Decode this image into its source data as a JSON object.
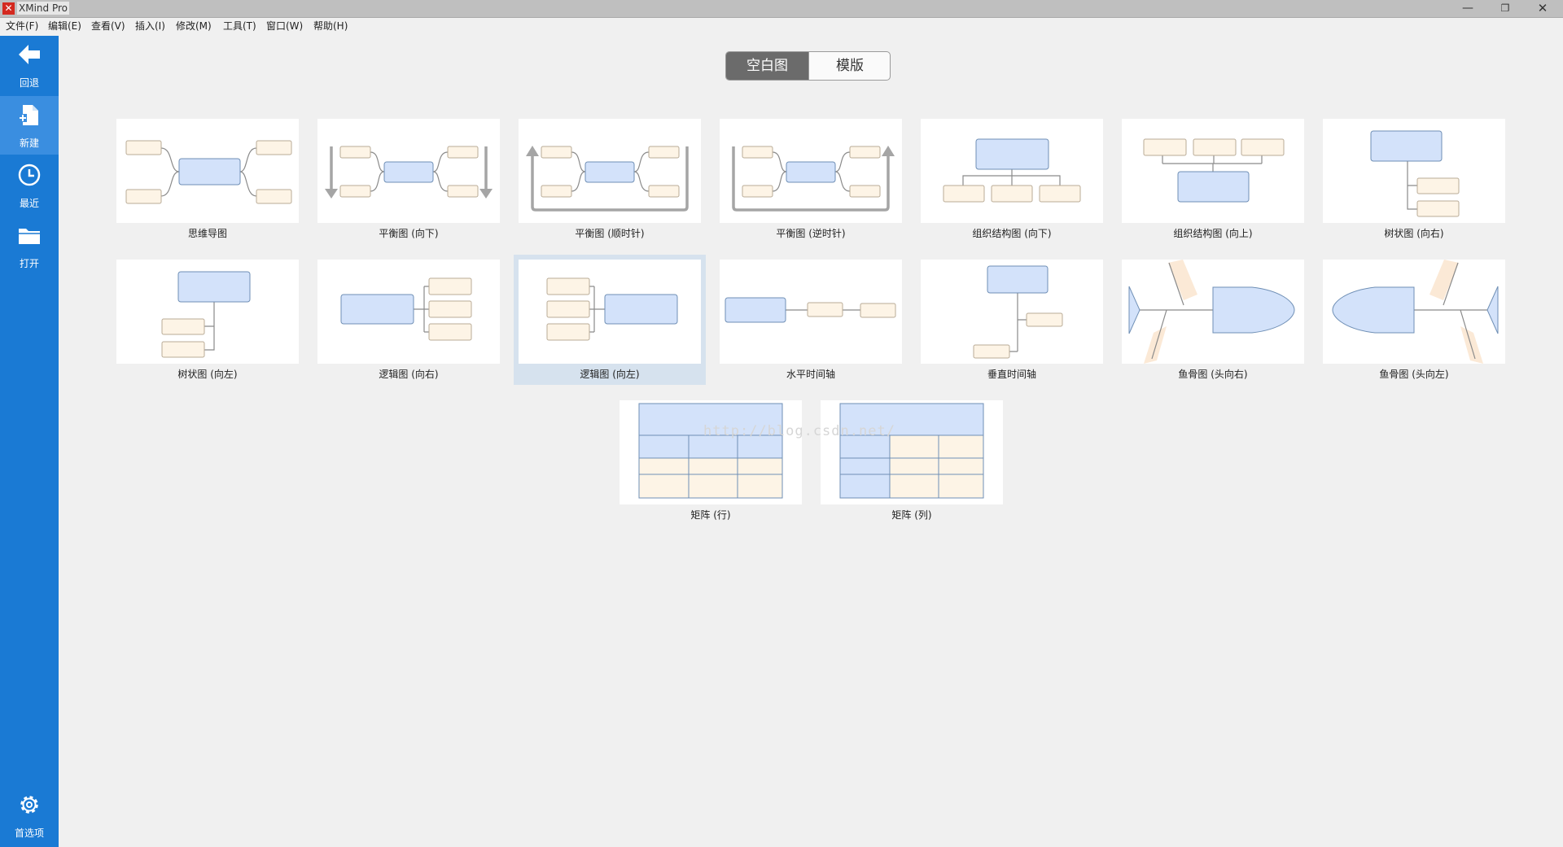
{
  "app": {
    "title": "XMind Pro",
    "icon": "xmind-logo-icon"
  },
  "window_controls": {
    "minimize": "—",
    "maximize": "❐",
    "close": "✕"
  },
  "menu": [
    "文件(F)",
    "编辑(E)",
    "查看(V)",
    "插入(I)",
    "修改(M)",
    "工具(T)",
    "窗口(W)",
    "帮助(H)"
  ],
  "sidebar": {
    "items": [
      {
        "label": "回退",
        "icon": "back-arrow-icon"
      },
      {
        "label": "新建",
        "icon": "new-document-icon",
        "active": true
      },
      {
        "label": "最近",
        "icon": "clock-icon"
      },
      {
        "label": "打开",
        "icon": "folder-icon"
      }
    ],
    "preferences": {
      "label": "首选项",
      "icon": "gear-icon"
    }
  },
  "tabs": {
    "blank": "空白图",
    "templates": "模版",
    "active": "空白图"
  },
  "templates": [
    {
      "label": "思维导图"
    },
    {
      "label": "平衡图 (向下)"
    },
    {
      "label": "平衡图 (顺时针)"
    },
    {
      "label": "平衡图 (逆时针)"
    },
    {
      "label": "组织结构图 (向下)"
    },
    {
      "label": "组织结构图 (向上)"
    },
    {
      "label": "树状图 (向右)"
    },
    {
      "label": "树状图 (向左)"
    },
    {
      "label": "逻辑图 (向右)"
    },
    {
      "label": "逻辑图 (向左)",
      "selected": true
    },
    {
      "label": "水平时间轴"
    },
    {
      "label": "垂直时间轴"
    },
    {
      "label": "鱼骨图 (头向右)"
    },
    {
      "label": "鱼骨图 (头向左)"
    },
    {
      "label": "矩阵 (行)"
    },
    {
      "label": "矩阵 (列)"
    }
  ],
  "colors": {
    "sidebar": "#1a7ad4",
    "topic_fill": "#fdf4e6",
    "central_fill": "#d3e2fa",
    "selected_bg": "#d6e2ee"
  },
  "watermark": "http://blog.csdn.net/"
}
